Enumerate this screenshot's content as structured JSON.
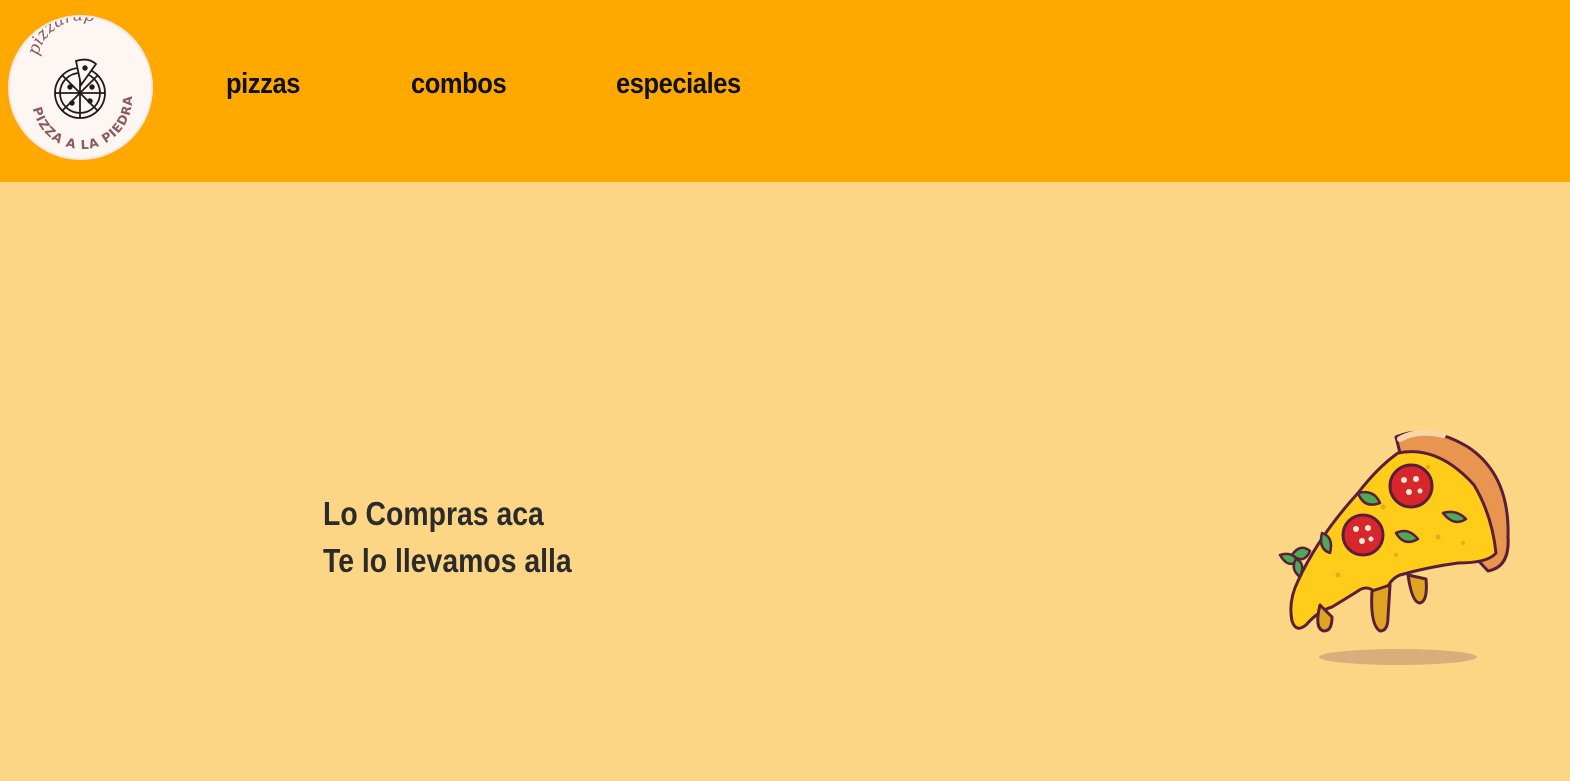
{
  "header": {
    "logo": {
      "brand_text": "pizzarap",
      "tagline": "PIZZA A LA PIEDRA",
      "icon": "pizza-icon"
    },
    "nav": [
      {
        "label": "pizzas"
      },
      {
        "label": "combos"
      },
      {
        "label": "especiales"
      }
    ]
  },
  "hero": {
    "line1": "Lo Compras aca",
    "line2": "Te lo llevamos alla",
    "illustration": "pizza-slice-illustration"
  },
  "colors": {
    "header_bg": "#ffa900",
    "page_bg": "#fdd685",
    "text_dark": "#2b2b2b",
    "nav_text": "#111111"
  }
}
